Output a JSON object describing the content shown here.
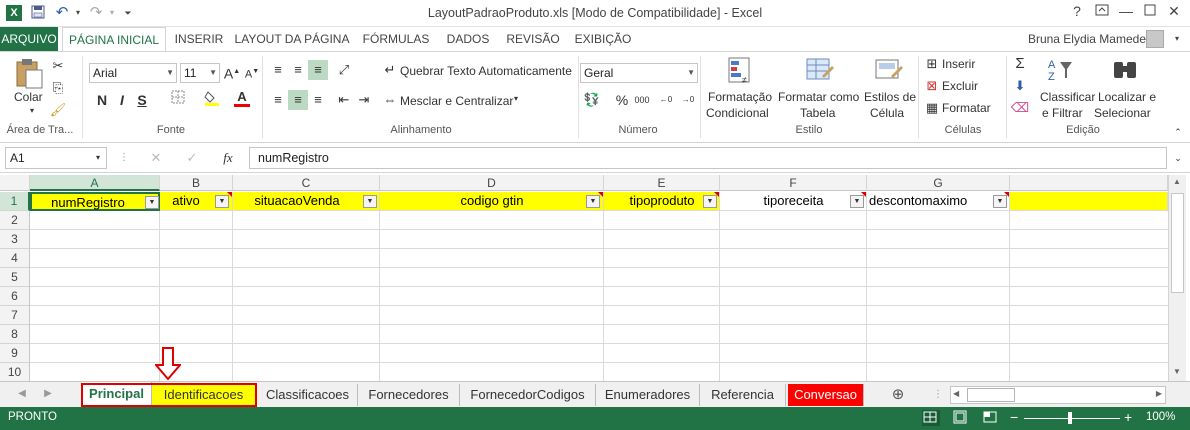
{
  "titlebar": {
    "title": "LayoutPadraoProduto.xls  [Modo de Compatibilidade] - Excel",
    "help": "?",
    "minimize": "—",
    "close": "✕"
  },
  "tabs": {
    "file": "ARQUIVO",
    "home": "PÁGINA INICIAL",
    "insert": "INSERIR",
    "layout": "LAYOUT DA PÁGINA",
    "formulas": "FÓRMULAS",
    "data": "DADOS",
    "review": "REVISÃO",
    "view": "EXIBIÇÃO",
    "user": "Bruna Elydia Mamede"
  },
  "ribbon": {
    "clipboard": {
      "paste": "Colar",
      "label": "Área de Tra..."
    },
    "font": {
      "name": "Arial",
      "size": "11",
      "bold": "N",
      "italic": "I",
      "underline": "S",
      "label": "Fonte"
    },
    "alignment": {
      "wrap": "Quebrar Texto Automaticamente",
      "merge": "Mesclar e Centralizar",
      "label": "Alinhamento"
    },
    "number": {
      "format": "Geral",
      "percent": "%",
      "thousands": "000",
      "label": "Número"
    },
    "styles": {
      "cond_line1": "Formatação",
      "cond_line2": "Condicional",
      "table_line1": "Formatar como",
      "table_line2": "Tabela",
      "cell_line1": "Estilos de",
      "cell_line2": "Célula",
      "label": "Estilo"
    },
    "cells": {
      "insert": "Inserir",
      "delete": "Excluir",
      "format": "Formatar",
      "label": "Células"
    },
    "editing": {
      "sort_line1": "Classificar",
      "sort_line2": "e Filtrar",
      "find_line1": "Localizar e",
      "find_line2": "Selecionar",
      "label": "Edição"
    }
  },
  "formula_bar": {
    "name_box": "A1",
    "fx": "fx",
    "value": "numRegistro"
  },
  "grid": {
    "columns": [
      "A",
      "B",
      "C",
      "D",
      "E",
      "F",
      "G"
    ],
    "rows": [
      "1",
      "2",
      "3",
      "4",
      "5",
      "6",
      "7",
      "8",
      "9",
      "10"
    ],
    "row1": [
      "numRegistro",
      "ativo",
      "situacaoVenda",
      "codigo gtin",
      "tipoproduto",
      "tiporeceita",
      "descontomaximo"
    ]
  },
  "sheets": [
    "Principal",
    "Identificacoes",
    "Classificacoes",
    "Fornecedores",
    "FornecedorCodigos",
    "Enumeradores",
    "Referencia",
    "Conversao"
  ],
  "status": {
    "ready": "PRONTO",
    "zoom": "100%"
  },
  "colors": {
    "excel_green": "#217346",
    "highlight": "#ffff00",
    "tab_red": "#ff0000",
    "annotation_red": "#e00000"
  }
}
